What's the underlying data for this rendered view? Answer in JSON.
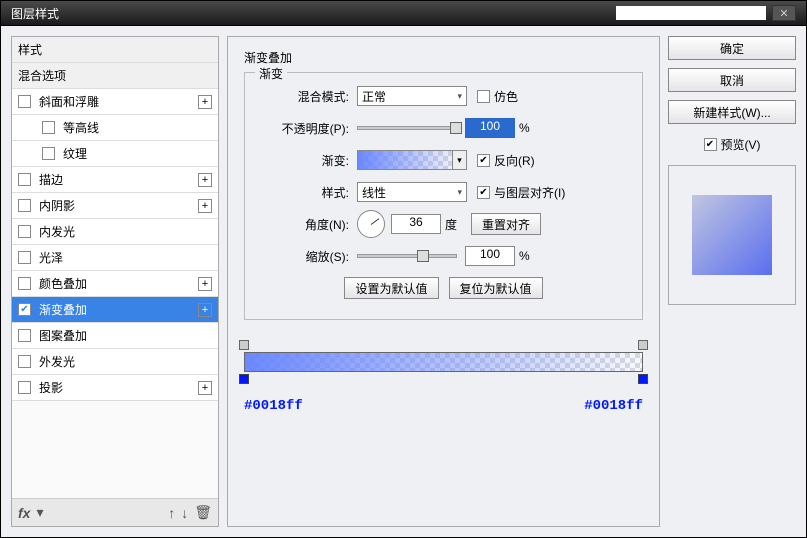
{
  "window": {
    "title": "图层样式"
  },
  "styles_list": {
    "header_styles": "样式",
    "blending_options": "混合选项",
    "items": [
      {
        "label": "斜面和浮雕",
        "checked": false,
        "indent": false,
        "plus": true
      },
      {
        "label": "等高线",
        "checked": false,
        "indent": true,
        "plus": false
      },
      {
        "label": "纹理",
        "checked": false,
        "indent": true,
        "plus": false
      },
      {
        "label": "描边",
        "checked": false,
        "indent": false,
        "plus": true
      },
      {
        "label": "内阴影",
        "checked": false,
        "indent": false,
        "plus": true
      },
      {
        "label": "内发光",
        "checked": false,
        "indent": false,
        "plus": false
      },
      {
        "label": "光泽",
        "checked": false,
        "indent": false,
        "plus": false
      },
      {
        "label": "颜色叠加",
        "checked": false,
        "indent": false,
        "plus": true
      },
      {
        "label": "渐变叠加",
        "checked": true,
        "indent": false,
        "plus": true,
        "active": true
      },
      {
        "label": "图案叠加",
        "checked": false,
        "indent": false,
        "plus": false
      },
      {
        "label": "外发光",
        "checked": false,
        "indent": false,
        "plus": false
      },
      {
        "label": "投影",
        "checked": false,
        "indent": false,
        "plus": true
      }
    ]
  },
  "footer_icons": {
    "fx": "fx",
    "down": "▾",
    "up": "⬆",
    "down2": "⬇",
    "trash": "🗑"
  },
  "center": {
    "section_title": "渐变叠加",
    "group_legend": "渐变",
    "labels": {
      "blend_mode": "混合模式:",
      "opacity": "不透明度(P):",
      "gradient": "渐变:",
      "style": "样式:",
      "angle": "角度(N):",
      "scale": "缩放(S):"
    },
    "blend_mode_value": "正常",
    "dither_label": "仿色",
    "dither_checked": false,
    "opacity_value": "100",
    "opacity_unit": "%",
    "reverse_label": "反向(R)",
    "reverse_checked": true,
    "style_value": "线性",
    "align_label": "与图层对齐(I)",
    "align_checked": true,
    "angle_value": "36",
    "angle_unit": "度",
    "reset_align_btn": "重置对齐",
    "scale_value": "100",
    "scale_unit": "%",
    "set_default_btn": "设置为默认值",
    "reset_default_btn": "复位为默认值",
    "hex_left": "#0018ff",
    "hex_right": "#0018ff"
  },
  "right": {
    "ok": "确定",
    "cancel": "取消",
    "new_style": "新建样式(W)...",
    "preview": "预览(V)",
    "preview_checked": true
  },
  "colors": {
    "accent": "#3a83e6",
    "hex": "#0018ff"
  }
}
